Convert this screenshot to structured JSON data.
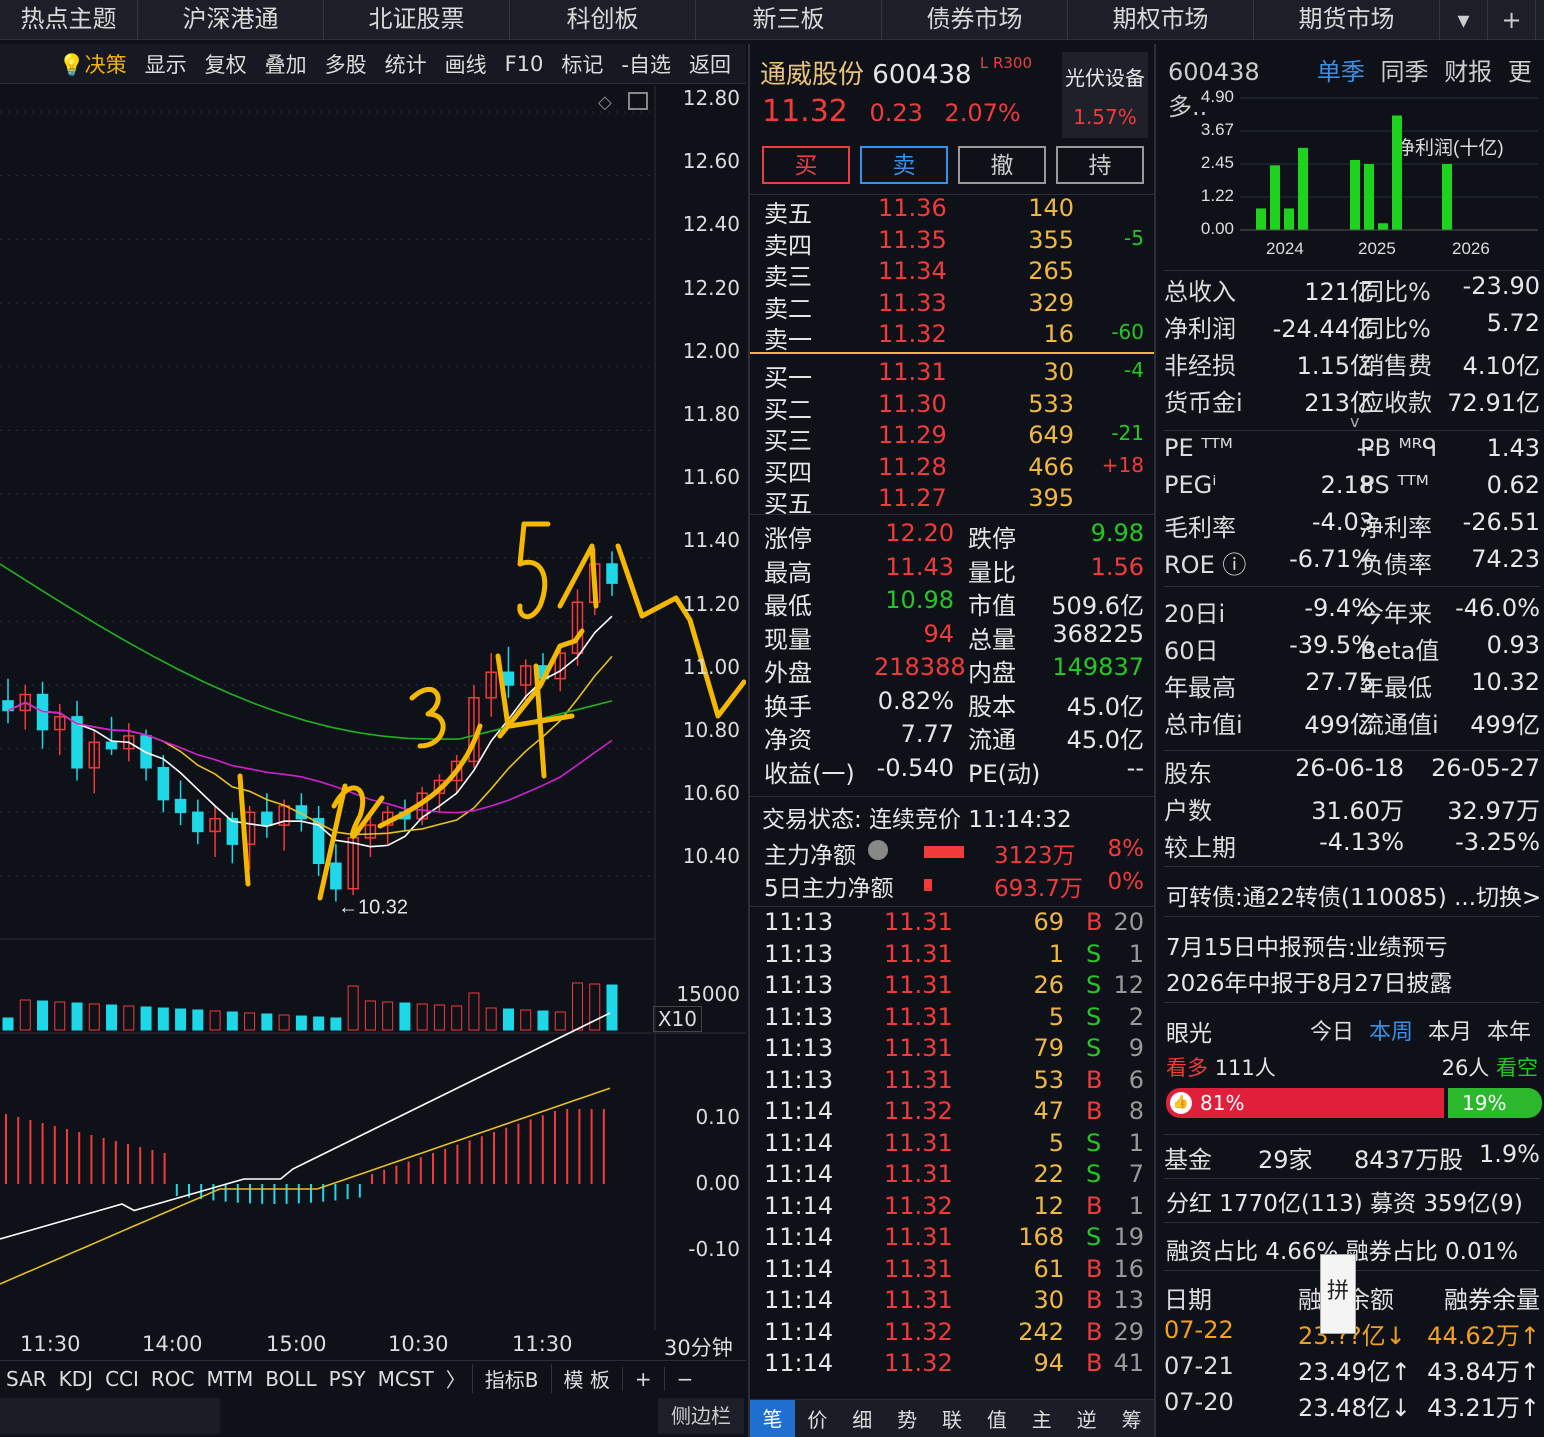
{
  "nav": {
    "items": [
      "热点主题",
      "沪深港通",
      "北证股票",
      "科创板",
      "新三板",
      "债券市场",
      "期权市场",
      "期货市场"
    ],
    "more_icon": "chevron-down-icon",
    "add_icon": "plus-icon"
  },
  "toolbar": {
    "items": [
      "决策",
      "显示",
      "复权",
      "叠加",
      "多股",
      "统计",
      "画线",
      "F10",
      "标记",
      "-自选",
      "返回"
    ]
  },
  "chart": {
    "price_axis": [
      "12.80",
      "12.60",
      "12.40",
      "12.20",
      "12.00",
      "11.80",
      "11.60",
      "11.40",
      "11.20",
      "11.00",
      "10.80",
      "10.60",
      "10.40"
    ],
    "low_marker": "←10.32",
    "volume_axis": "15000",
    "volume_unit": "X10",
    "macd_axis": [
      "0.10",
      "0.00",
      "-0.10"
    ],
    "x_ticks": [
      "11:30",
      "14:00",
      "15:00",
      "10:30",
      "11:30"
    ],
    "period": "30分钟",
    "annotation_digits": [
      "1",
      "2",
      "3",
      "4",
      "5"
    ]
  },
  "chart_data": {
    "type": "candlestick",
    "period": "30分钟",
    "ylim": [
      10.3,
      12.85
    ],
    "low_marker": 10.32,
    "candles": [
      {
        "o": 10.95,
        "h": 11.02,
        "l": 10.88,
        "c": 10.92
      },
      {
        "o": 10.92,
        "h": 11.0,
        "l": 10.86,
        "c": 10.97
      },
      {
        "o": 10.97,
        "h": 11.01,
        "l": 10.8,
        "c": 10.86
      },
      {
        "o": 10.86,
        "h": 10.94,
        "l": 10.78,
        "c": 10.9
      },
      {
        "o": 10.9,
        "h": 10.95,
        "l": 10.7,
        "c": 10.74
      },
      {
        "o": 10.74,
        "h": 10.86,
        "l": 10.66,
        "c": 10.82
      },
      {
        "o": 10.82,
        "h": 10.9,
        "l": 10.78,
        "c": 10.8
      },
      {
        "o": 10.8,
        "h": 10.88,
        "l": 10.76,
        "c": 10.84
      },
      {
        "o": 10.84,
        "h": 10.86,
        "l": 10.7,
        "c": 10.74
      },
      {
        "o": 10.74,
        "h": 10.78,
        "l": 10.6,
        "c": 10.64
      },
      {
        "o": 10.64,
        "h": 10.7,
        "l": 10.56,
        "c": 10.6
      },
      {
        "o": 10.6,
        "h": 10.64,
        "l": 10.5,
        "c": 10.54
      },
      {
        "o": 10.54,
        "h": 10.62,
        "l": 10.46,
        "c": 10.58
      },
      {
        "o": 10.58,
        "h": 10.6,
        "l": 10.44,
        "c": 10.5
      },
      {
        "o": 10.5,
        "h": 10.62,
        "l": 10.42,
        "c": 10.6
      },
      {
        "o": 10.6,
        "h": 10.66,
        "l": 10.52,
        "c": 10.56
      },
      {
        "o": 10.56,
        "h": 10.64,
        "l": 10.48,
        "c": 10.62
      },
      {
        "o": 10.62,
        "h": 10.66,
        "l": 10.54,
        "c": 10.58
      },
      {
        "o": 10.58,
        "h": 10.62,
        "l": 10.4,
        "c": 10.44
      },
      {
        "o": 10.44,
        "h": 10.5,
        "l": 10.32,
        "c": 10.36
      },
      {
        "o": 10.36,
        "h": 10.56,
        "l": 10.34,
        "c": 10.52
      },
      {
        "o": 10.52,
        "h": 10.6,
        "l": 10.46,
        "c": 10.56
      },
      {
        "o": 10.56,
        "h": 10.62,
        "l": 10.5,
        "c": 10.6
      },
      {
        "o": 10.6,
        "h": 10.64,
        "l": 10.54,
        "c": 10.58
      },
      {
        "o": 10.58,
        "h": 10.68,
        "l": 10.56,
        "c": 10.66
      },
      {
        "o": 10.66,
        "h": 10.72,
        "l": 10.6,
        "c": 10.7
      },
      {
        "o": 10.7,
        "h": 10.78,
        "l": 10.66,
        "c": 10.76
      },
      {
        "o": 10.76,
        "h": 11.0,
        "l": 10.74,
        "c": 10.96
      },
      {
        "o": 10.96,
        "h": 11.1,
        "l": 10.9,
        "c": 11.04
      },
      {
        "o": 11.04,
        "h": 11.12,
        "l": 10.96,
        "c": 11.0
      },
      {
        "o": 11.0,
        "h": 11.08,
        "l": 10.94,
        "c": 11.06
      },
      {
        "o": 11.06,
        "h": 11.1,
        "l": 11.0,
        "c": 11.02
      },
      {
        "o": 11.02,
        "h": 11.12,
        "l": 10.98,
        "c": 11.1
      },
      {
        "o": 11.1,
        "h": 11.3,
        "l": 11.06,
        "c": 11.26
      },
      {
        "o": 11.26,
        "h": 11.43,
        "l": 11.22,
        "c": 11.38
      },
      {
        "o": 11.38,
        "h": 11.42,
        "l": 11.28,
        "c": 11.32
      }
    ],
    "macd_ylim": [
      -0.15,
      0.15
    ]
  },
  "quote": {
    "name": "通威股份",
    "code": "600438",
    "lr": "L R",
    "idx": "300",
    "price": "11.32",
    "change": "0.23",
    "change_pct": "2.07%",
    "industry": "光伏设备",
    "industry_pct": "1.57%",
    "buttons": [
      "买",
      "卖",
      "撤",
      "持"
    ]
  },
  "orderbook": {
    "asks": [
      {
        "label": "卖五",
        "price": "11.36",
        "vol": "140",
        "chg": ""
      },
      {
        "label": "卖四",
        "price": "11.35",
        "vol": "355",
        "chg": "-5"
      },
      {
        "label": "卖三",
        "price": "11.34",
        "vol": "265",
        "chg": ""
      },
      {
        "label": "卖二",
        "price": "11.33",
        "vol": "329",
        "chg": ""
      },
      {
        "label": "卖一",
        "price": "11.32",
        "vol": "16",
        "chg": "-60"
      }
    ],
    "bids": [
      {
        "label": "买一",
        "price": "11.31",
        "vol": "30",
        "chg": "-4"
      },
      {
        "label": "买二",
        "price": "11.30",
        "vol": "533",
        "chg": ""
      },
      {
        "label": "买三",
        "price": "11.29",
        "vol": "649",
        "chg": "-21"
      },
      {
        "label": "买四",
        "price": "11.28",
        "vol": "466",
        "chg": "+18"
      },
      {
        "label": "买五",
        "price": "11.27",
        "vol": "395",
        "chg": ""
      }
    ]
  },
  "stats": [
    {
      "k1": "涨停",
      "v1": "12.20",
      "k2": "跌停",
      "v2": "9.98"
    },
    {
      "k1": "最高",
      "v1": "11.43",
      "k2": "量比",
      "v2": "1.56"
    },
    {
      "k1": "最低",
      "v1": "10.98",
      "k2": "市值",
      "v2": "509.6亿"
    },
    {
      "k1": "现量",
      "v1": "94",
      "k2": "总量",
      "v2": "368225"
    },
    {
      "k1": "外盘",
      "v1": "218388",
      "k2": "内盘",
      "v2": "149837"
    },
    {
      "k1": "换手",
      "v1": "0.82%",
      "k2": "股本",
      "v2": "45.0亿"
    },
    {
      "k1": "净资",
      "v1": "7.77",
      "k2": "流通",
      "v2": "45.0亿"
    },
    {
      "k1": "收益(一)",
      "v1": "-0.540",
      "k2": "PE(动)",
      "v2": "--"
    }
  ],
  "trade_status": "交易状态: 连续竞价 11:14:32",
  "capital": [
    {
      "label": "主力净额",
      "value": "3123万",
      "pct": "8%"
    },
    {
      "label": "5日主力净额",
      "value": "693.7万",
      "pct": "0%"
    }
  ],
  "ticks": [
    {
      "t": "11:13",
      "p": "11.31",
      "v": "69",
      "bs": "B",
      "n": "20"
    },
    {
      "t": "11:13",
      "p": "11.31",
      "v": "1",
      "bs": "S",
      "n": "1"
    },
    {
      "t": "11:13",
      "p": "11.31",
      "v": "26",
      "bs": "S",
      "n": "12"
    },
    {
      "t": "11:13",
      "p": "11.31",
      "v": "5",
      "bs": "S",
      "n": "2"
    },
    {
      "t": "11:13",
      "p": "11.31",
      "v": "79",
      "bs": "S",
      "n": "9"
    },
    {
      "t": "11:13",
      "p": "11.31",
      "v": "53",
      "bs": "B",
      "n": "6"
    },
    {
      "t": "11:14",
      "p": "11.32",
      "v": "47",
      "bs": "B",
      "n": "8"
    },
    {
      "t": "11:14",
      "p": "11.31",
      "v": "5",
      "bs": "S",
      "n": "1"
    },
    {
      "t": "11:14",
      "p": "11.31",
      "v": "22",
      "bs": "S",
      "n": "7"
    },
    {
      "t": "11:14",
      "p": "11.32",
      "v": "12",
      "bs": "B",
      "n": "1"
    },
    {
      "t": "11:14",
      "p": "11.31",
      "v": "168",
      "bs": "S",
      "n": "19"
    },
    {
      "t": "11:14",
      "p": "11.31",
      "v": "61",
      "bs": "B",
      "n": "16"
    },
    {
      "t": "11:14",
      "p": "11.31",
      "v": "30",
      "bs": "B",
      "n": "13"
    },
    {
      "t": "11:14",
      "p": "11.32",
      "v": "242",
      "bs": "B",
      "n": "29"
    },
    {
      "t": "11:14",
      "p": "11.32",
      "v": "94",
      "bs": "B",
      "n": "41"
    }
  ],
  "mid_tabs": [
    "笔",
    "价",
    "细",
    "势",
    "联",
    "值",
    "主",
    "逆",
    "筹"
  ],
  "indicators": [
    "SAR",
    "KDJ",
    "CCI",
    "ROC",
    "MTM",
    "BOLL",
    "PSY",
    "MCST",
    "〉",
    "指标B",
    "模 板",
    "+",
    "−"
  ],
  "sidebar_label": "侧边栏",
  "fin": {
    "code": "600438",
    "tabs": [
      "单季",
      "同季",
      "财报",
      "更多.."
    ],
    "chart_title": "净利润(十亿)",
    "y_ticks": [
      "4.90",
      "3.67",
      "2.45",
      "1.22",
      "0.00"
    ],
    "years": [
      "2024",
      "2025",
      "2026"
    ],
    "rows": [
      {
        "a": "总收入",
        "b": "121亿",
        "c": "同比%",
        "d": "-23.90"
      },
      {
        "a": "净利润",
        "b": "-24.44亿",
        "c": "同比%",
        "d": "5.72"
      },
      {
        "a": "非经损",
        "b": "1.15亿",
        "c": "销售费",
        "d": "4.10亿"
      },
      {
        "a": "货币金i",
        "b": "213亿",
        "c": "应收款",
        "d": "72.91亿"
      }
    ],
    "valuation": [
      {
        "a": "PE ᵀᵀᴹ",
        "b": "--",
        "c": "PB ᴹᴿᑫ",
        "d": "1.43"
      },
      {
        "a": "PEGⁱ",
        "b": "2.18",
        "c": "PS ᵀᵀᴹ",
        "d": "0.62"
      },
      {
        "a": "毛利率",
        "b": "-4.03",
        "c": "净利率",
        "d": "-26.51"
      },
      {
        "a": "ROE ⓘ",
        "b": "-6.71%",
        "c": "负债率",
        "d": "74.23"
      }
    ],
    "perf": [
      {
        "a": "20日i",
        "b": "-9.4%",
        "c": "今年来",
        "d": "-46.0%"
      },
      {
        "a": "60日",
        "b": "-39.5%",
        "c": "Beta值",
        "d": "0.93"
      },
      {
        "a": "年最高",
        "b": "27.75",
        "c": "年最低",
        "d": "10.32"
      },
      {
        "a": "总市值i",
        "b": "499亿",
        "c": "流通值i",
        "d": "499亿"
      }
    ],
    "holders": [
      {
        "a": "股东",
        "b": "26-06-18",
        "d": "26-05-27"
      },
      {
        "a": "户数",
        "b": "31.60万",
        "d": "32.97万"
      },
      {
        "a": "较上期",
        "b": "-4.13%",
        "d": "-3.25%"
      }
    ],
    "convertible": "可转债:通22转债(110085) ...切换>",
    "notice1": "7月15日中报预告:业绩预亏",
    "notice2": "2026年中报于8月27日披露",
    "sentiment": {
      "title": "眼光",
      "periods": [
        "今日",
        "本周",
        "本月",
        "本年"
      ],
      "bull_label": "看多",
      "bull_count": "111人",
      "bear_count": "26人",
      "bear_label": "看空",
      "bull_pct": "81%",
      "bear_pct": "19%"
    },
    "fund": {
      "a": "基金",
      "b": "29家",
      "c": "8437万股",
      "d": "1.9%"
    },
    "dividend": "分红 1770亿(113) 募资 359亿(9)",
    "margin": "融资占比 4.66% 融券占比 0.01%",
    "margin_head": [
      "日期",
      "融资余额",
      "融券余量"
    ],
    "margin_rows": [
      {
        "d": "07-22",
        "a": "23.??亿↓",
        "b": "44.62万↑"
      },
      {
        "d": "07-21",
        "a": "23.49亿↑",
        "b": "43.84万↑"
      },
      {
        "d": "07-20",
        "a": "23.48亿↓",
        "b": "43.21万↑"
      }
    ],
    "ime_char": "拼"
  }
}
